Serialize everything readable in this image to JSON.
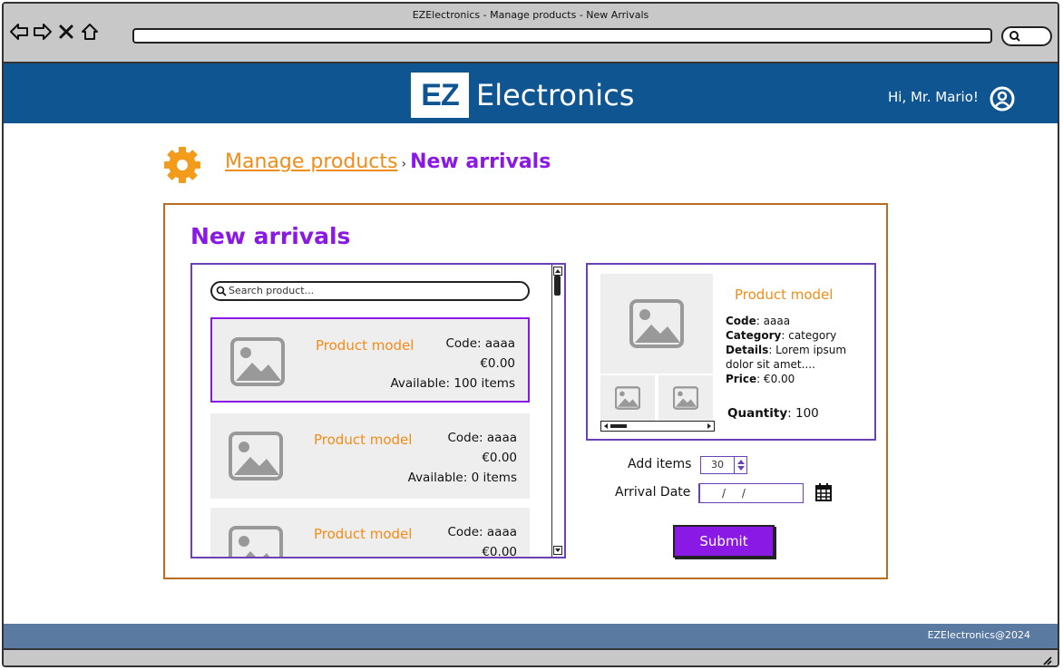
{
  "window": {
    "title": "EZElectronics - Manage products - New Arrivals"
  },
  "browser": {
    "icons": [
      "back-arrow-icon",
      "forward-arrow-icon",
      "close-icon",
      "home-icon",
      "search-icon"
    ]
  },
  "header": {
    "logo_mark": "EZ",
    "logo_text": "Electronics",
    "greeting": "Hi, Mr. Mario!",
    "user_icon": "user-circle-icon",
    "background": "#0e5591"
  },
  "breadcrumb": {
    "icon": "gear-icon",
    "parent": "Manage products",
    "separator": "›",
    "current": "New arrivals"
  },
  "panel": {
    "title": "New arrivals",
    "search": {
      "placeholder": "Search product..."
    },
    "products": [
      {
        "model": "Product model",
        "code": "Code: aaaa",
        "price": "€0.00",
        "available": "Available: 100 items",
        "selected": true
      },
      {
        "model": "Product model",
        "code": "Code: aaaa",
        "price": "€0.00",
        "available": "Available: 0 items",
        "selected": false
      },
      {
        "model": "Product model",
        "code": "Code: aaaa",
        "price": "€0.00",
        "available": "",
        "selected": false
      }
    ],
    "detail": {
      "model": "Product model",
      "code_label": "Code",
      "code_value": ": aaaa",
      "category_label": "Category",
      "category_value": ": category",
      "details_label": "Details",
      "details_value": ": Lorem ipsum dolor sit amet....",
      "price_label": "Price",
      "price_value": ": €0.00",
      "quantity_label": "Quantity",
      "quantity_value": ": 100"
    },
    "form": {
      "add_items_label": "Add items",
      "add_items_value": "30",
      "arrival_date_label": "Arrival Date",
      "arrival_date_value": "/ /",
      "submit_label": "Submit"
    }
  },
  "footer": {
    "text": "EZElectronics@2024"
  },
  "colors": {
    "accent": "#8a19e6",
    "orange": "#f08c18",
    "panel_border": "#b96d1f",
    "list_border": "#6a42b8",
    "footer": "#5a7aa1"
  }
}
